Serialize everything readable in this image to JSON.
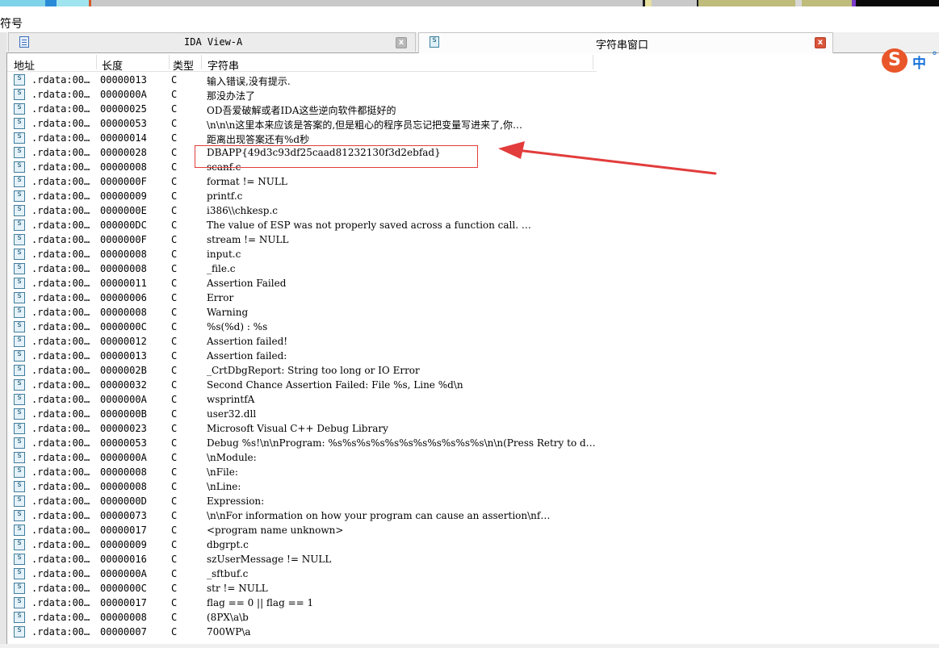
{
  "window": {
    "section_label": "符号",
    "tabs": [
      {
        "label": "IDA View-A",
        "close": "x"
      },
      {
        "label": "字符串窗口",
        "close": "x"
      }
    ]
  },
  "columns": [
    "地址",
    "长度",
    "类型",
    "字符串"
  ],
  "rows": [
    {
      "addr": ".rdata:00…",
      "len": "00000013",
      "type": "C",
      "str": "输入错误,没有提示."
    },
    {
      "addr": ".rdata:00…",
      "len": "0000000A",
      "type": "C",
      "str": "那没办法了"
    },
    {
      "addr": ".rdata:00…",
      "len": "00000025",
      "type": "C",
      "str": "OD吾爱破解或者IDA这些逆向软件都挺好的"
    },
    {
      "addr": ".rdata:00…",
      "len": "00000053",
      "type": "C",
      "str": "\\n\\n\\n这里本来应该是答案的,但是粗心的程序员忘记把变量写进来了,你…"
    },
    {
      "addr": ".rdata:00…",
      "len": "00000014",
      "type": "C",
      "str": "距离出现答案还有%d秒"
    },
    {
      "addr": ".rdata:00…",
      "len": "00000028",
      "type": "C",
      "str": "DBAPP{49d3c93df25caad81232130f3d2ebfad}"
    },
    {
      "addr": ".rdata:00…",
      "len": "00000008",
      "type": "C",
      "str": "scanf.c"
    },
    {
      "addr": ".rdata:00…",
      "len": "0000000F",
      "type": "C",
      "str": "format != NULL"
    },
    {
      "addr": ".rdata:00…",
      "len": "00000009",
      "type": "C",
      "str": "printf.c"
    },
    {
      "addr": ".rdata:00…",
      "len": "0000000E",
      "type": "C",
      "str": "i386\\\\chkesp.c"
    },
    {
      "addr": ".rdata:00…",
      "len": "000000DC",
      "type": "C",
      "str": "The value of ESP was not properly saved across a function call.  …"
    },
    {
      "addr": ".rdata:00…",
      "len": "0000000F",
      "type": "C",
      "str": "stream != NULL"
    },
    {
      "addr": ".rdata:00…",
      "len": "00000008",
      "type": "C",
      "str": "input.c"
    },
    {
      "addr": ".rdata:00…",
      "len": "00000008",
      "type": "C",
      "str": "_file.c"
    },
    {
      "addr": ".rdata:00…",
      "len": "00000011",
      "type": "C",
      "str": "Assertion Failed"
    },
    {
      "addr": ".rdata:00…",
      "len": "00000006",
      "type": "C",
      "str": "Error"
    },
    {
      "addr": ".rdata:00…",
      "len": "00000008",
      "type": "C",
      "str": "Warning"
    },
    {
      "addr": ".rdata:00…",
      "len": "0000000C",
      "type": "C",
      "str": "%s(%d) : %s"
    },
    {
      "addr": ".rdata:00…",
      "len": "00000012",
      "type": "C",
      "str": "Assertion failed!"
    },
    {
      "addr": ".rdata:00…",
      "len": "00000013",
      "type": "C",
      "str": "Assertion failed:"
    },
    {
      "addr": ".rdata:00…",
      "len": "0000002B",
      "type": "C",
      "str": "_CrtDbgReport: String too long or IO Error"
    },
    {
      "addr": ".rdata:00…",
      "len": "00000032",
      "type": "C",
      "str": "Second Chance Assertion Failed: File %s, Line %d\\n"
    },
    {
      "addr": ".rdata:00…",
      "len": "0000000A",
      "type": "C",
      "str": "wsprintfA"
    },
    {
      "addr": ".rdata:00…",
      "len": "0000000B",
      "type": "C",
      "str": "user32.dll"
    },
    {
      "addr": ".rdata:00…",
      "len": "00000023",
      "type": "C",
      "str": "Microsoft Visual C++ Debug Library"
    },
    {
      "addr": ".rdata:00…",
      "len": "00000053",
      "type": "C",
      "str": "Debug %s!\\n\\nProgram: %s%s%s%s%s%s%s%s%s%s%s\\n\\n(Press Retry to d…"
    },
    {
      "addr": ".rdata:00…",
      "len": "0000000A",
      "type": "C",
      "str": "\\nModule:"
    },
    {
      "addr": ".rdata:00…",
      "len": "00000008",
      "type": "C",
      "str": "\\nFile:"
    },
    {
      "addr": ".rdata:00…",
      "len": "00000008",
      "type": "C",
      "str": "\\nLine:"
    },
    {
      "addr": ".rdata:00…",
      "len": "0000000D",
      "type": "C",
      "str": "Expression:"
    },
    {
      "addr": ".rdata:00…",
      "len": "00000073",
      "type": "C",
      "str": "\\n\\nFor information on how your program can cause an assertion\\nf…"
    },
    {
      "addr": ".rdata:00…",
      "len": "00000017",
      "type": "C",
      "str": "<program name unknown>"
    },
    {
      "addr": ".rdata:00…",
      "len": "00000009",
      "type": "C",
      "str": "dbgrpt.c"
    },
    {
      "addr": ".rdata:00…",
      "len": "00000016",
      "type": "C",
      "str": "szUserMessage != NULL"
    },
    {
      "addr": ".rdata:00…",
      "len": "0000000A",
      "type": "C",
      "str": "_sftbuf.c"
    },
    {
      "addr": ".rdata:00…",
      "len": "0000000C",
      "type": "C",
      "str": "str != NULL"
    },
    {
      "addr": ".rdata:00…",
      "len": "00000017",
      "type": "C",
      "str": "flag == 0 || flag == 1"
    },
    {
      "addr": ".rdata:00…",
      "len": "00000008",
      "type": "C",
      "str": " (8PX\\a\\b"
    },
    {
      "addr": ".rdata:00…",
      "len": "00000007",
      "type": "C",
      "str": "700WP\\a"
    }
  ],
  "ime": {
    "logo": "S",
    "mode": "中",
    "punct": "°"
  },
  "colors": {
    "highlight": "#e23c3c",
    "ime_brand": "#e8562a"
  }
}
